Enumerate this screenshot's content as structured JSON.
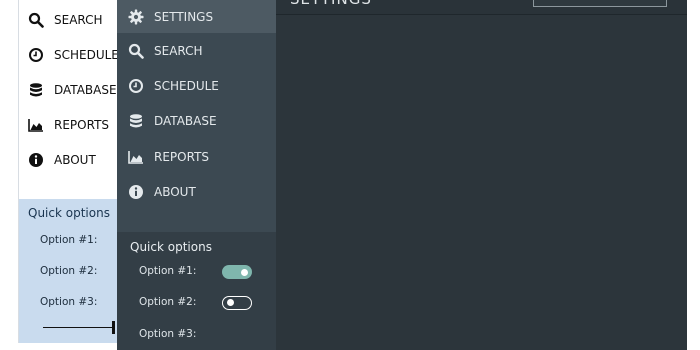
{
  "light_menu": {
    "items": [
      {
        "label": "SEARCH",
        "icon": "search-icon"
      },
      {
        "label": "SCHEDULE",
        "icon": "clock-icon"
      },
      {
        "label": "DATABASE",
        "icon": "database-icon"
      },
      {
        "label": "REPORTS",
        "icon": "area-chart-icon"
      },
      {
        "label": "ABOUT",
        "icon": "info-icon"
      }
    ],
    "quick_options": {
      "title": "Quick options",
      "options": [
        {
          "label": "Option #1:"
        },
        {
          "label": "Option #2:"
        },
        {
          "label": "Option #3:",
          "control": "slider",
          "level": 1.0
        }
      ]
    }
  },
  "dark_menu": {
    "items": [
      {
        "label": "SETTINGS",
        "icon": "gear-icon",
        "active": true
      },
      {
        "label": "SEARCH",
        "icon": "search-icon"
      },
      {
        "label": "SCHEDULE",
        "icon": "clock-icon"
      },
      {
        "label": "DATABASE",
        "icon": "database-icon"
      },
      {
        "label": "REPORTS",
        "icon": "area-chart-icon"
      },
      {
        "label": "ABOUT",
        "icon": "info-icon"
      }
    ],
    "quick_options": {
      "title": "Quick options",
      "options": [
        {
          "label": "Option #1:",
          "control": "toggle",
          "on": true
        },
        {
          "label": "Option #2:",
          "control": "toggle",
          "on": false
        },
        {
          "label": "Option #3:"
        }
      ]
    }
  },
  "main": {
    "title": "SETTINGS"
  },
  "colors": {
    "dark_panel": "#3c4952",
    "dark_active": "#4d5a63",
    "main_bg": "#2c353b",
    "light_quick_bg": "#c9dbee",
    "toggle_on": "#7fb6ad"
  }
}
